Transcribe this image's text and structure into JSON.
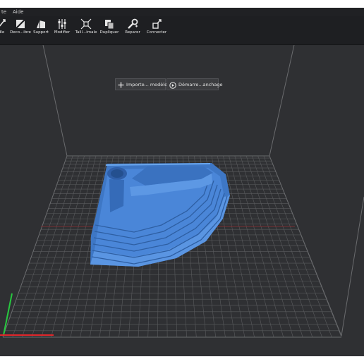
{
  "menubar": {
    "items": [
      "te",
      "Aide"
    ]
  },
  "toolbar": {
    "buttons": [
      {
        "label": "dle",
        "icon": "model-icon"
      },
      {
        "label": "Deco...ibre",
        "icon": "decompose-icon"
      },
      {
        "label": "Support",
        "icon": "support-icon"
      },
      {
        "label": "Modifier",
        "icon": "sliders-icon"
      },
      {
        "label": "Taill...imale",
        "icon": "max-size-icon"
      },
      {
        "label": "Dupliquer",
        "icon": "duplicate-icon"
      },
      {
        "label": "Reparer",
        "icon": "repair-icon"
      },
      {
        "label": "Connecter",
        "icon": "connect-icon"
      }
    ]
  },
  "actions": {
    "import": "Importe... modèle",
    "import_icon": "plus-icon",
    "start": "Démarre...anchage",
    "start_icon": "play-icon"
  },
  "colors": {
    "background": "#2f3033",
    "toolbar": "#1e1f22",
    "grid": "#5a5b5e",
    "model": "#4a86d8",
    "axis_x": "#e0262a",
    "axis_y": "#27c93f"
  }
}
